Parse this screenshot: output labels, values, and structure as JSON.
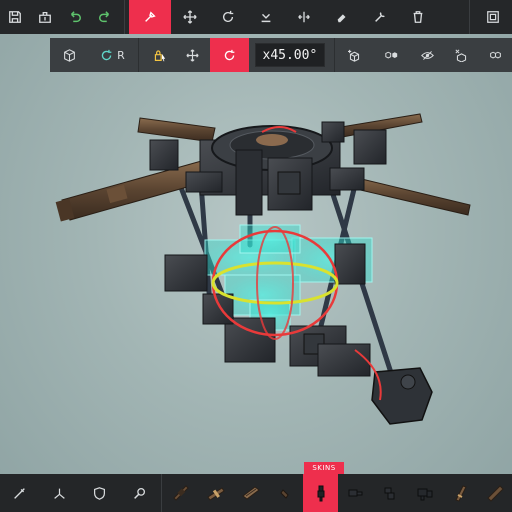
{
  "toolbar": {
    "buttons": [
      {
        "icon": "save-icon"
      },
      {
        "icon": "load-icon"
      },
      {
        "icon": "undo-icon"
      },
      {
        "icon": "redo-icon"
      },
      {
        "icon": "build-mode-icon",
        "active": true
      },
      {
        "icon": "move-icon"
      },
      {
        "icon": "rotate-icon"
      },
      {
        "icon": "snap-down-icon"
      },
      {
        "icon": "flip-icon"
      },
      {
        "icon": "erase-icon"
      },
      {
        "icon": "wrench-icon"
      },
      {
        "icon": "trash-icon"
      },
      {
        "icon": "settings-panel-icon"
      }
    ]
  },
  "subtoolbar": {
    "local_space_label": "R",
    "angle_value": "x45.00°",
    "buttons": [
      {
        "icon": "block-view-icon"
      },
      {
        "icon": "local-space-icon"
      },
      {
        "icon": "lock-select-icon"
      },
      {
        "icon": "translate-icon"
      },
      {
        "icon": "rotate-gizmo-icon",
        "active": true
      },
      {
        "icon": "add-block-icon"
      },
      {
        "icon": "convert-block-icon"
      },
      {
        "icon": "hide-block-icon"
      },
      {
        "icon": "remove-block-icon"
      },
      {
        "icon": "grid-icon"
      }
    ]
  },
  "bottombar": {
    "skins_label": "SKINS",
    "tools": [
      {
        "icon": "needle-tool-icon"
      },
      {
        "icon": "mirror-tool-icon"
      },
      {
        "icon": "shield-tool-icon"
      },
      {
        "icon": "search-tool-icon"
      }
    ],
    "skins_active_index": 4,
    "skin_count": 10
  },
  "colors": {
    "accent": "#ee2f4d",
    "toolbar": "#252729",
    "subbar": "#3a3e41",
    "background": "#a6b8b7",
    "selection": "#3ff2e0",
    "gizmo_ring_x": "#e8e22a",
    "gizmo_ring_y": "#e83a3a"
  }
}
